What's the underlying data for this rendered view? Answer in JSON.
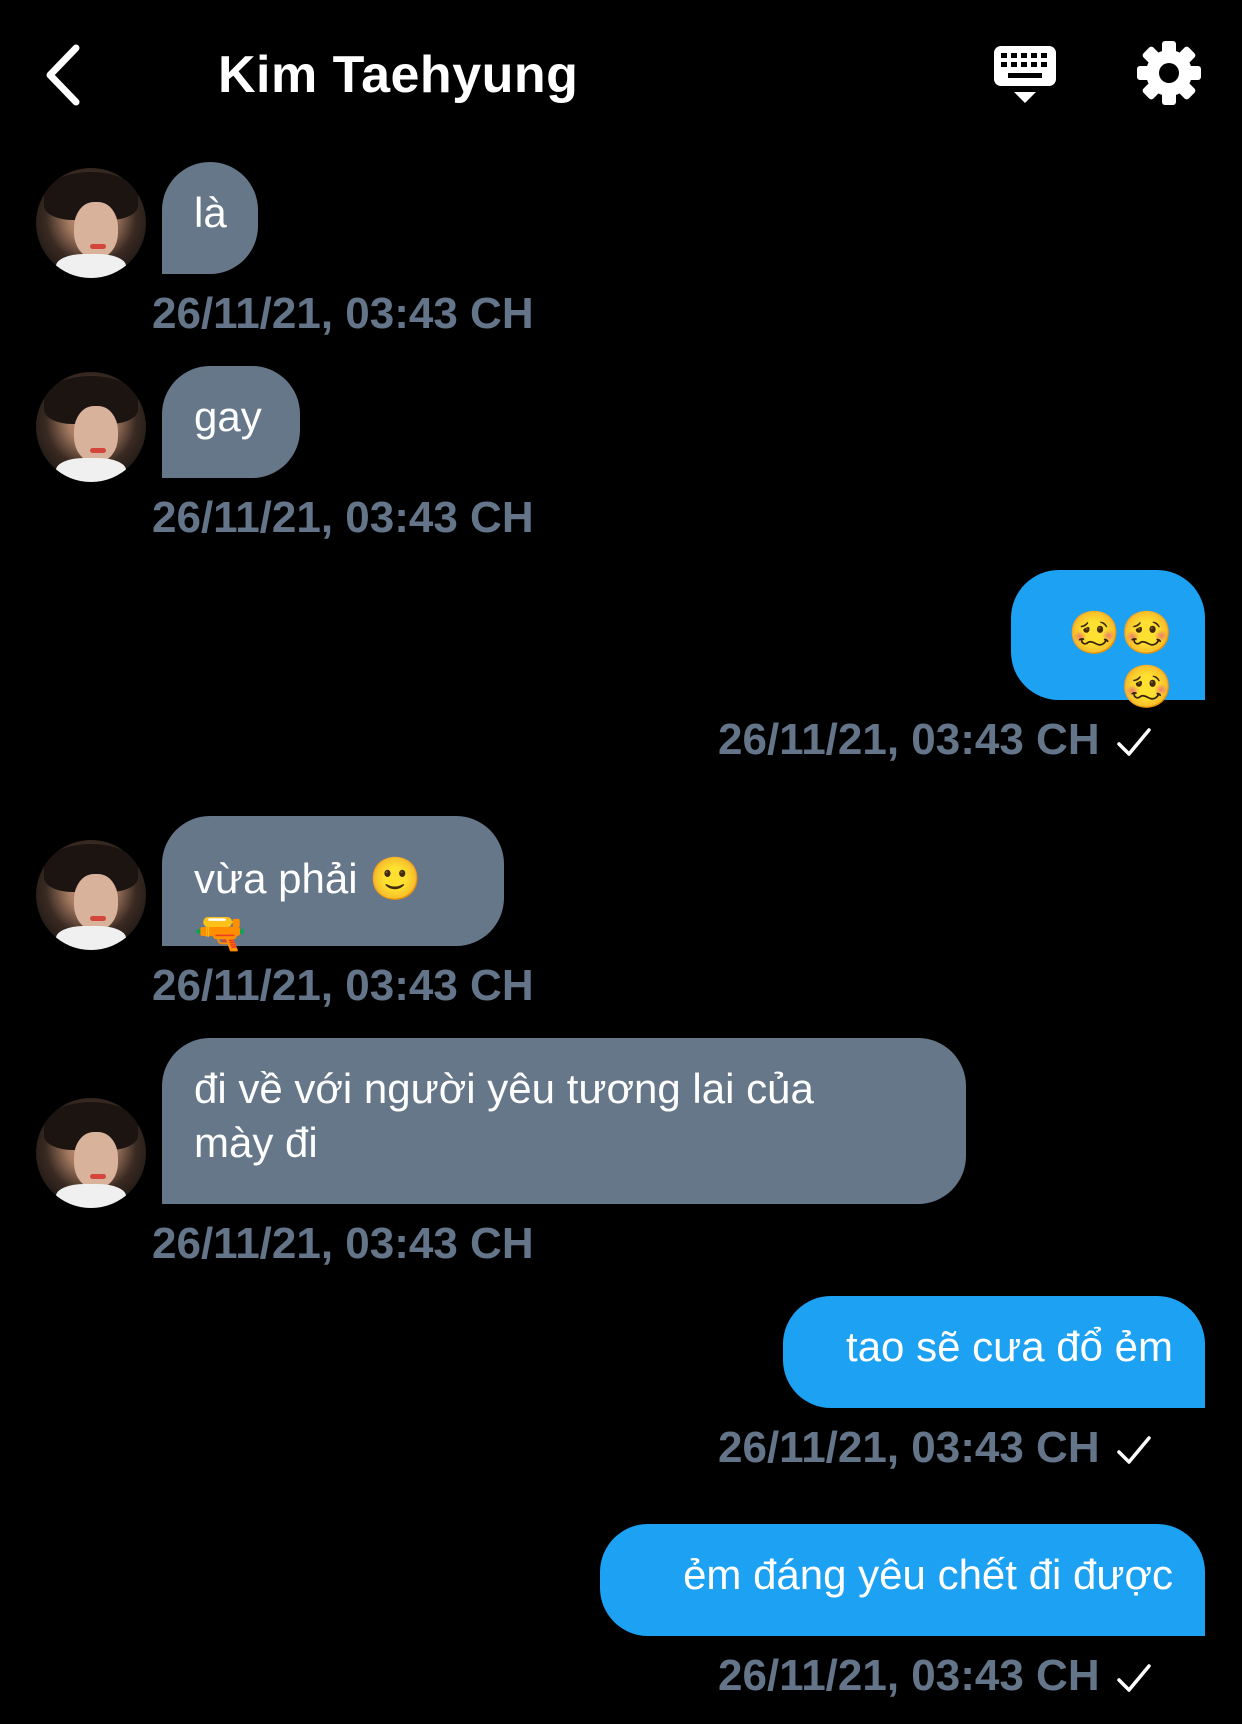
{
  "header": {
    "title": "Kim Taehyung",
    "back_icon": "chevron-left-icon",
    "keyboard_icon": "keyboard-icon",
    "settings_icon": "gear-icon"
  },
  "colors": {
    "background": "#000000",
    "incoming_bubble": "#66778a",
    "outgoing_bubble": "#1da1f2",
    "timestamp": "#64758a"
  },
  "messages": [
    {
      "direction": "incoming",
      "text": "là",
      "time": "26/11/21, 03:43 CH"
    },
    {
      "direction": "incoming",
      "text": "gay",
      "time": "26/11/21, 03:43 CH"
    },
    {
      "direction": "outgoing",
      "text": "🥴🥴🥴",
      "time": "26/11/21, 03:43 CH",
      "status_icon": "check-icon"
    },
    {
      "direction": "incoming",
      "text": "vừa phải 🙂🔫",
      "time": "26/11/21, 03:43 CH"
    },
    {
      "direction": "incoming",
      "text": "đi về với người yêu tương lai của mày đi",
      "time": "26/11/21, 03:43 CH"
    },
    {
      "direction": "outgoing",
      "text": "tao sẽ cưa đổ ẻm",
      "time": "26/11/21, 03:43 CH",
      "status_icon": "check-icon"
    },
    {
      "direction": "outgoing",
      "text": "ẻm đáng yêu chết đi được",
      "time": "26/11/21, 03:43 CH",
      "status_icon": "check-icon"
    }
  ]
}
